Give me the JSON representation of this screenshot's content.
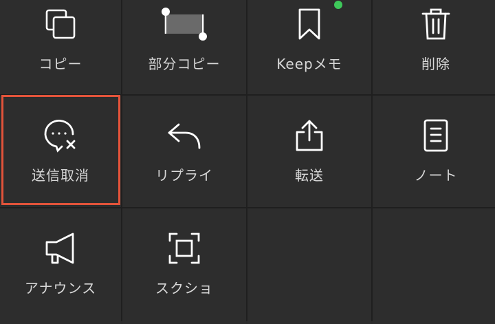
{
  "menu": {
    "items": [
      {
        "id": "copy",
        "label": "コピー",
        "icon": "copy-icon"
      },
      {
        "id": "partial-copy",
        "label": "部分コピー",
        "icon": "partial-copy-icon"
      },
      {
        "id": "keep-memo",
        "label": "Keepメモ",
        "icon": "bookmark-icon"
      },
      {
        "id": "delete",
        "label": "削除",
        "icon": "trash-icon"
      },
      {
        "id": "unsend",
        "label": "送信取消",
        "icon": "unsend-bubble-icon"
      },
      {
        "id": "reply",
        "label": "リプライ",
        "icon": "reply-arrow-icon"
      },
      {
        "id": "forward",
        "label": "転送",
        "icon": "share-upload-icon"
      },
      {
        "id": "note",
        "label": "ノート",
        "icon": "note-icon"
      },
      {
        "id": "announce",
        "label": "アナウンス",
        "icon": "megaphone-icon"
      },
      {
        "id": "screenshot",
        "label": "スクショ",
        "icon": "screenshot-frame-icon"
      }
    ]
  },
  "highlighted_item": "unsend",
  "colors": {
    "background": "#2d2d2d",
    "divider": "#1f1f1f",
    "icon": "#ffffff",
    "label": "#d8d8d8",
    "highlight_border": "#e2533a",
    "new_badge": "#3ec85a"
  }
}
